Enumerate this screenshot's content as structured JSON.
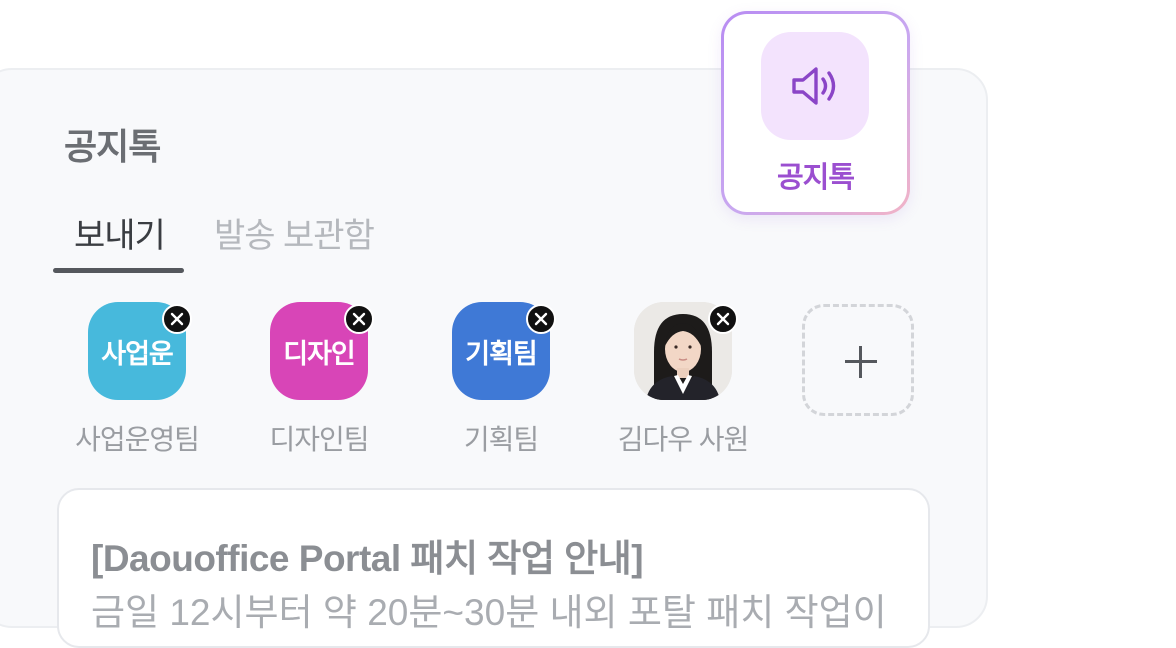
{
  "panel": {
    "title": "공지톡"
  },
  "tabs": [
    {
      "label": "보내기",
      "active": true
    },
    {
      "label": "발송 보관함",
      "active": false
    }
  ],
  "recipients": [
    {
      "avatar_text": "사업운",
      "name": "사업운영팀",
      "color": "#47b9dc"
    },
    {
      "avatar_text": "디자인",
      "name": "디자인팀",
      "color": "#d845b7"
    },
    {
      "avatar_text": "기획팀",
      "name": "기획팀",
      "color": "#3f79d6"
    },
    {
      "avatar_text": "",
      "name": "김다우 사원",
      "color": "#e9e7e4",
      "icon": "person-photo-icon"
    }
  ],
  "add_recipient": {
    "icon": "plus-icon"
  },
  "message": {
    "title": "[Daouoffice Portal 패치 작업 안내]",
    "body": "금일 12시부터 약 20분~30분 내외 포탈 패치 작업이"
  },
  "notice_button": {
    "label": "공지톡",
    "icon": "speaker-icon",
    "accent": "#9b4fd0"
  }
}
